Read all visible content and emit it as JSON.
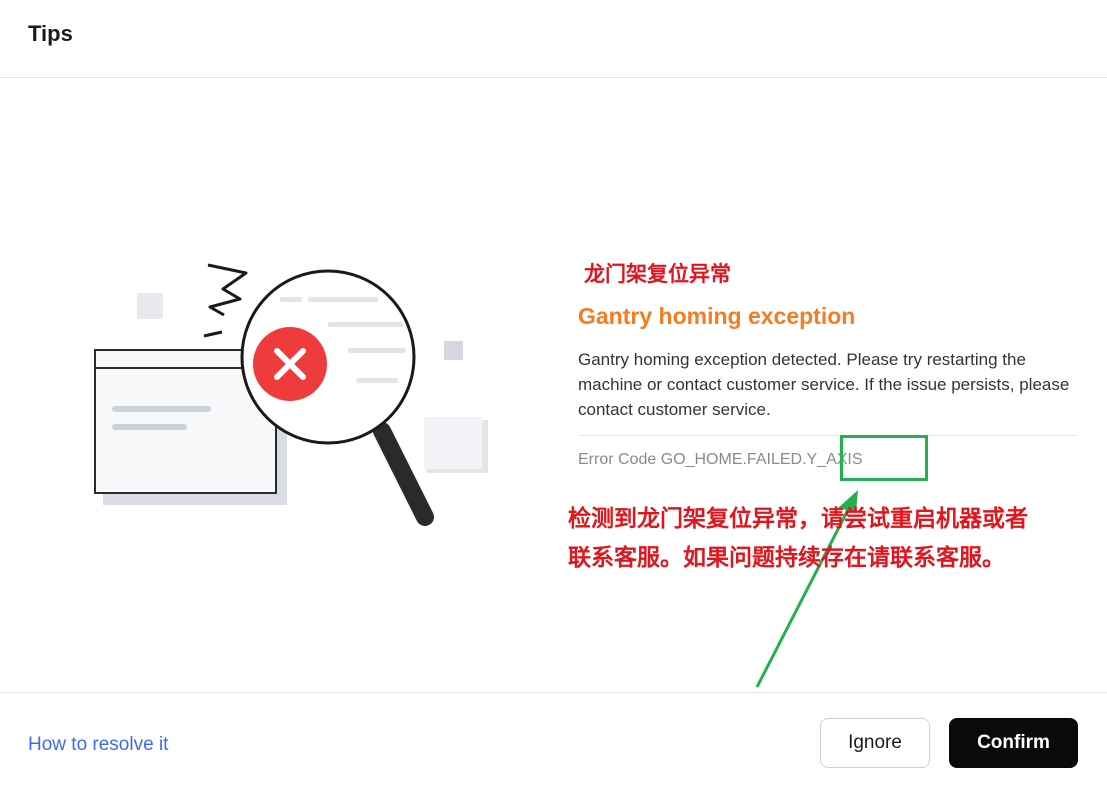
{
  "dialog": {
    "title": "Tips"
  },
  "error": {
    "title_cn": "龙门架复位异常",
    "title_en": "Gantry homing exception",
    "description": "Gantry homing exception detected. Please try restarting the machine or contact customer service. If the issue persists, please contact customer service.",
    "error_code": "Error Code GO_HOME.FAILED.Y_AXIS",
    "note_cn": "检测到龙门架复位异常，请尝试重启机器或者联系客服。如果问题持续存在请联系客服。"
  },
  "footer": {
    "resolve_link": "How to resolve it",
    "ignore_label": "Ignore",
    "confirm_label": "Confirm"
  },
  "colors": {
    "cn_red": "#e0161e",
    "en_orange": "#f57c1f",
    "annotation_green": "#22b14c",
    "link_blue": "#3d6bf5",
    "error_icon_red": "#ee3b3b"
  },
  "icons": {
    "illustration": "magnifier-error-illustration",
    "error": "close-icon"
  }
}
